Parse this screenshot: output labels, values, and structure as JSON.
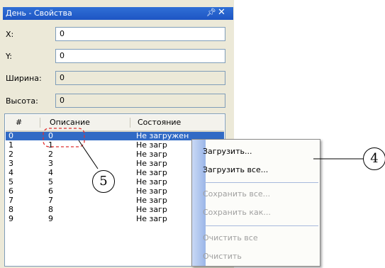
{
  "window": {
    "title": "День - Свойства",
    "pin_icon": "pin-icon",
    "close_icon": "close-icon"
  },
  "fields": [
    {
      "label": "X:",
      "value": "0",
      "readonly": false
    },
    {
      "label": "Y:",
      "value": "0",
      "readonly": false
    },
    {
      "label": "Ширина:",
      "value": "0",
      "readonly": true
    },
    {
      "label": "Высота:",
      "value": "0",
      "readonly": true
    }
  ],
  "list": {
    "columns": [
      "#",
      "Описание",
      "Состояние"
    ],
    "rows": [
      {
        "num": "0",
        "desc": "0",
        "state": "Не загружен",
        "selected": true
      },
      {
        "num": "1",
        "desc": "1",
        "state": "Не загр"
      },
      {
        "num": "2",
        "desc": "2",
        "state": "Не загр"
      },
      {
        "num": "3",
        "desc": "3",
        "state": "Не загр"
      },
      {
        "num": "4",
        "desc": "4",
        "state": "Не загр"
      },
      {
        "num": "5",
        "desc": "5",
        "state": "Не загр"
      },
      {
        "num": "6",
        "desc": "6",
        "state": "Не загр"
      },
      {
        "num": "7",
        "desc": "7",
        "state": "Не загр"
      },
      {
        "num": "8",
        "desc": "8",
        "state": "Не загр"
      },
      {
        "num": "9",
        "desc": "9",
        "state": "Не загр"
      }
    ]
  },
  "context_menu": {
    "load": "Загрузить...",
    "load_all": "Загрузить все...",
    "save_all": "Сохранить все...",
    "save_as": "Сохранить как...",
    "clear_all": "Очистить все",
    "clear": "Очистить"
  },
  "callouts": {
    "c4": "4",
    "c5": "5"
  },
  "colors": {
    "selection": "#316ac5",
    "titlebar": "#1e55c4",
    "highlight_dash": "#e03030"
  }
}
